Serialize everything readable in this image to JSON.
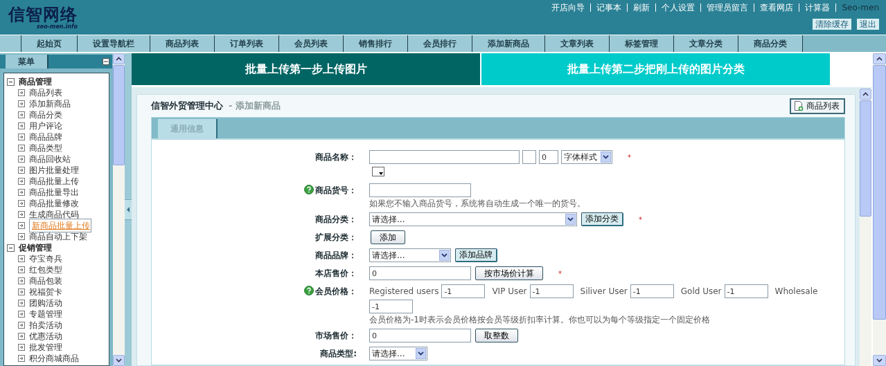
{
  "header": {
    "logo": "信智网络",
    "logo_sub": "seo-men.info",
    "links": [
      {
        "label": "开店向导"
      },
      {
        "label": "记事本"
      },
      {
        "label": "刷新"
      },
      {
        "label": "个人设置"
      },
      {
        "label": "管理员留言"
      },
      {
        "label": "查看网店"
      },
      {
        "label": "计算器"
      }
    ],
    "user": "Seo-men",
    "buttons": [
      "清除缓存",
      "退出"
    ]
  },
  "nav": [
    {
      "label": "起始页"
    },
    {
      "label": "设置导航栏"
    },
    {
      "label": "商品列表"
    },
    {
      "label": "订单列表"
    },
    {
      "label": "会员列表"
    },
    {
      "label": "销售排行"
    },
    {
      "label": "会员排行"
    },
    {
      "label": "添加新商品"
    },
    {
      "label": "文章列表"
    },
    {
      "label": "标签管理"
    },
    {
      "label": "文章分类"
    },
    {
      "label": "商品分类"
    }
  ],
  "sidebar": {
    "tab": "菜单",
    "groups": [
      {
        "label": "商品管理",
        "expanded": true,
        "children": [
          {
            "label": "商品列表",
            "selected": false
          },
          {
            "label": "添加新商品",
            "selected": false
          },
          {
            "label": "商品分类",
            "selected": false
          },
          {
            "label": "用户评论",
            "selected": false
          },
          {
            "label": "商品品牌",
            "selected": false
          },
          {
            "label": "商品类型",
            "selected": false
          },
          {
            "label": "商品回收站",
            "selected": false
          },
          {
            "label": "图片批量处理",
            "selected": false
          },
          {
            "label": "商品批量上传",
            "selected": false
          },
          {
            "label": "商品批量导出",
            "selected": false
          },
          {
            "label": "商品批量修改",
            "selected": false
          },
          {
            "label": "生成商品代码",
            "selected": false
          },
          {
            "label": "新商品批量上传",
            "selected": true
          },
          {
            "label": "商品自动上下架",
            "selected": false
          }
        ]
      },
      {
        "label": "促销管理",
        "expanded": true,
        "children": [
          {
            "label": "夺宝奇兵",
            "selected": false
          },
          {
            "label": "红包类型",
            "selected": false
          },
          {
            "label": "商品包装",
            "selected": false
          },
          {
            "label": "祝福贺卡",
            "selected": false
          },
          {
            "label": "团购活动",
            "selected": false
          },
          {
            "label": "专题管理",
            "selected": false
          },
          {
            "label": "拍卖活动",
            "selected": false
          },
          {
            "label": "优惠活动",
            "selected": false
          },
          {
            "label": "批发管理",
            "selected": false
          },
          {
            "label": "积分商城商品",
            "selected": false
          }
        ]
      }
    ]
  },
  "banners": [
    {
      "label": "批量上传第一步上传图片",
      "selected": true
    },
    {
      "label": "批量上传第二步把刚上传的图片分类",
      "selected": false
    }
  ],
  "panel": {
    "title": "信智外贸管理中心",
    "subtitle": "- 添加新商品",
    "list_button": "商品列表",
    "tabs": [
      {
        "label": "通用信息",
        "selected": true
      }
    ]
  },
  "form": [
    {
      "label": "商品名称：",
      "help": false,
      "lines": [
        [
          {
            "kind": "input-long"
          },
          {
            "kind": "input-square"
          },
          {
            "kind": "input-short",
            "value": "0"
          },
          {
            "kind": "select-small",
            "value": "字体样式"
          },
          {
            "kind": "required",
            "text": "*"
          }
        ],
        [
          {
            "kind": "color-picker"
          }
        ]
      ]
    },
    {
      "label": "商品货号：",
      "help": true,
      "lines": [
        [
          {
            "kind": "input"
          }
        ]
      ],
      "note": "如果您不输入商品货号，系统将自动生成一个唯一的货号。"
    },
    {
      "label": "商品分类：",
      "help": false,
      "lines": [
        [
          {
            "kind": "select-long",
            "value": "请选择..."
          },
          {
            "kind": "button-light",
            "label": "添加分类"
          },
          {
            "kind": "required",
            "text": "*"
          }
        ]
      ]
    },
    {
      "label": "扩展分类：",
      "help": false,
      "lines": [
        [
          {
            "kind": "button",
            "label": "添加"
          }
        ]
      ]
    },
    {
      "label": "商品品牌：",
      "help": false,
      "lines": [
        [
          {
            "kind": "select",
            "value": "请选择..."
          },
          {
            "kind": "button-light",
            "label": "添加品牌"
          }
        ]
      ]
    },
    {
      "label": "本店售价：",
      "help": false,
      "lines": [
        [
          {
            "kind": "input",
            "value": "0"
          },
          {
            "kind": "button",
            "label": "按市场价计算"
          },
          {
            "kind": "required",
            "text": "*"
          }
        ]
      ]
    },
    {
      "label": "会员价格：",
      "help": true,
      "lines": [
        [
          {
            "kind": "caption",
            "text": "Registered users"
          },
          {
            "kind": "input-price",
            "value": "-1"
          },
          {
            "kind": "caption",
            "text": "VIP User"
          },
          {
            "kind": "input-price",
            "value": "-1"
          },
          {
            "kind": "caption",
            "text": "Siliver User"
          },
          {
            "kind": "input-price",
            "value": "-1"
          },
          {
            "kind": "caption",
            "text": "Gold User"
          },
          {
            "kind": "input-price",
            "value": "-1"
          },
          {
            "kind": "caption",
            "text": "Wholesale"
          }
        ],
        [
          {
            "kind": "input-price",
            "value": "-1"
          }
        ]
      ],
      "note": "会员价格为-1时表示会员价格按会员等级折扣率计算。你也可以为每个等级指定一个固定价格"
    },
    {
      "label": "市场售价：",
      "help": false,
      "lines": [
        [
          {
            "kind": "input",
            "value": "0"
          },
          {
            "kind": "button",
            "label": "取整数"
          }
        ]
      ]
    },
    {
      "label": "商品类型:",
      "help": false,
      "lines": [
        [
          {
            "kind": "select-type",
            "value": "请选择..."
          }
        ]
      ]
    }
  ]
}
